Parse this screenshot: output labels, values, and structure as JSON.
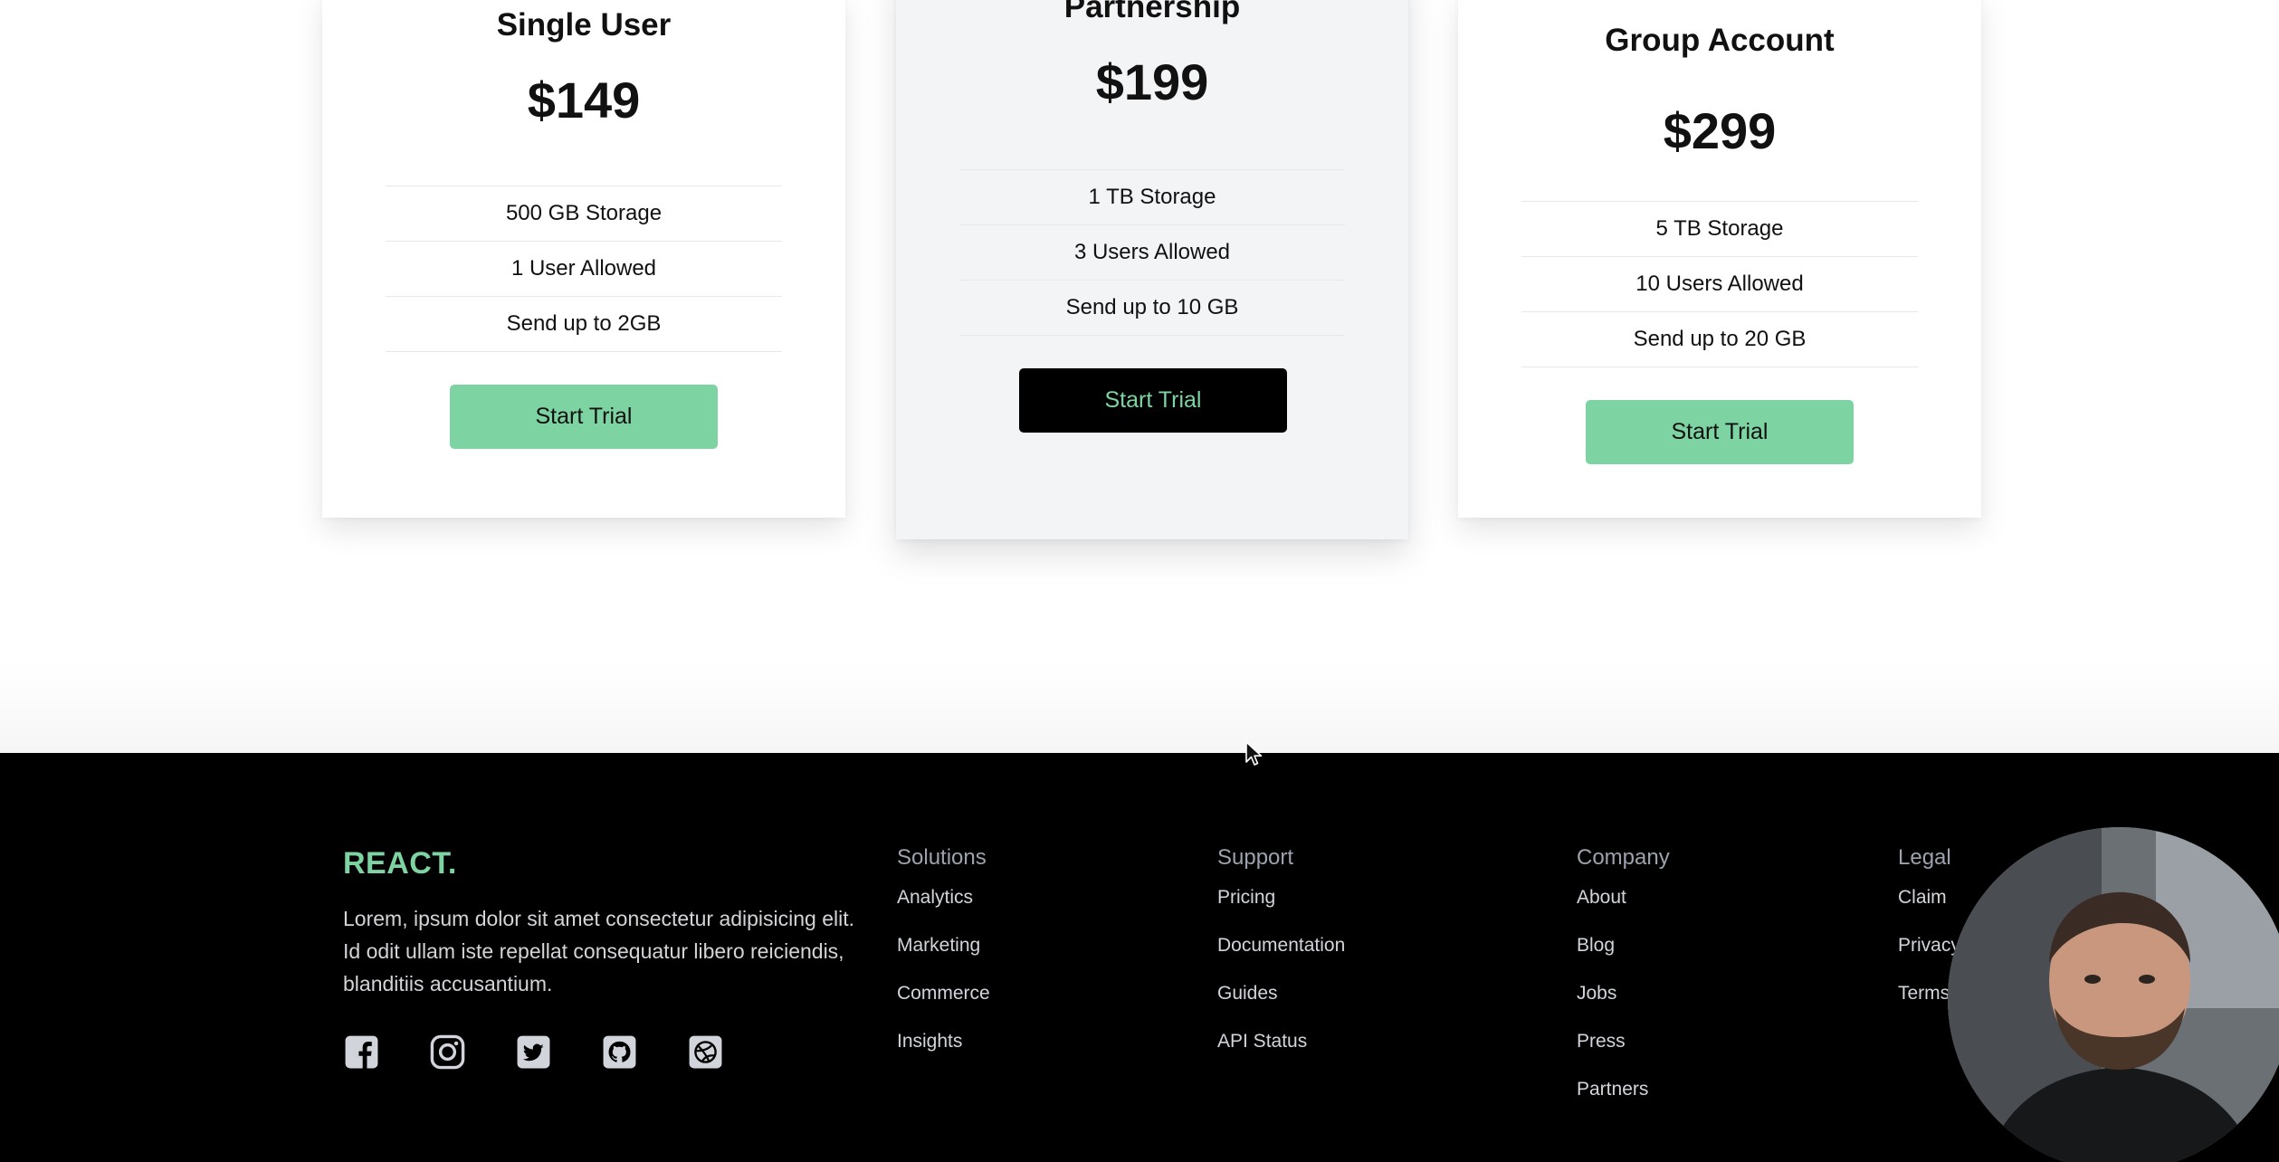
{
  "plans": [
    {
      "title": "Single User",
      "price": "$149",
      "features": [
        "500 GB Storage",
        "1 User Allowed",
        "Send up to 2GB"
      ],
      "cta": "Start Trial"
    },
    {
      "title": "Partnership",
      "price": "$199",
      "features": [
        "1 TB Storage",
        "3 Users Allowed",
        "Send up to 10 GB"
      ],
      "cta": "Start Trial"
    },
    {
      "title": "Group Account",
      "price": "$299",
      "features": [
        "5 TB Storage",
        "10 Users Allowed",
        "Send up to 20 GB"
      ],
      "cta": "Start Trial"
    }
  ],
  "footer": {
    "brand": "REACT.",
    "blurb": "Lorem, ipsum dolor sit amet consectetur adipisicing elit. Id odit ullam iste repellat consequatur libero reiciendis, blanditiis accusantium.",
    "socials": [
      "facebook-icon",
      "instagram-icon",
      "twitter-icon",
      "github-icon",
      "dribbble-icon"
    ],
    "columns": [
      {
        "heading": "Solutions",
        "links": [
          "Analytics",
          "Marketing",
          "Commerce",
          "Insights"
        ]
      },
      {
        "heading": "Support",
        "links": [
          "Pricing",
          "Documentation",
          "Guides",
          "API Status"
        ]
      },
      {
        "heading": "Company",
        "links": [
          "About",
          "Blog",
          "Jobs",
          "Press",
          "Partners"
        ]
      },
      {
        "heading": "Legal",
        "links": [
          "Claim",
          "Privacy",
          "Terms"
        ]
      }
    ]
  },
  "colors": {
    "accent": "#7dd3a2",
    "footer_bg": "#000000",
    "card_bg": "#ffffff",
    "featured_bg": "#f3f4f6"
  }
}
